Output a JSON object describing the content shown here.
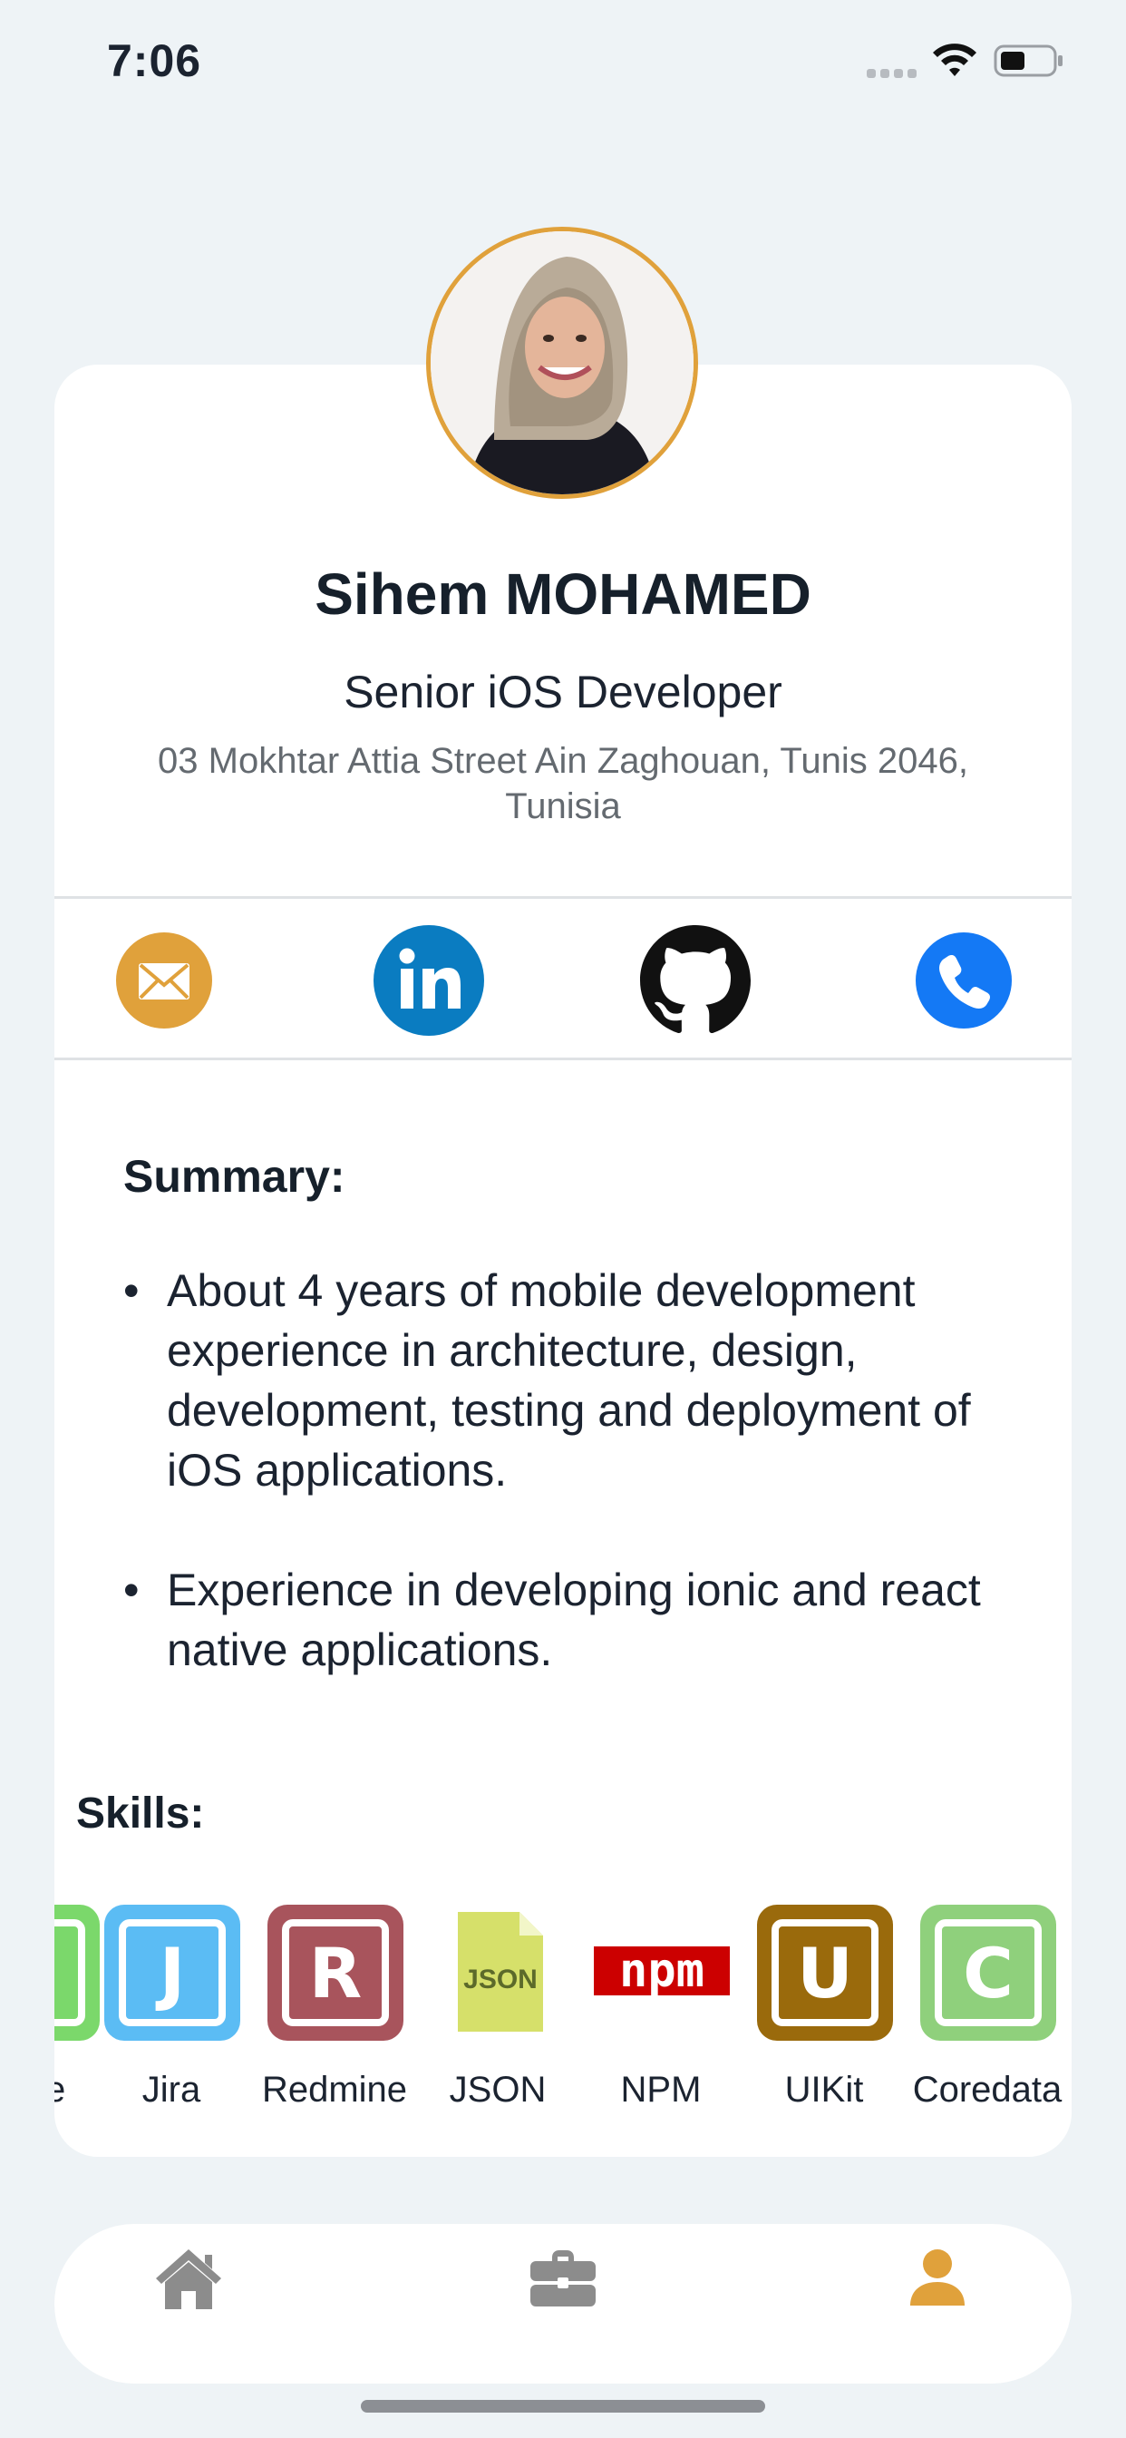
{
  "status_bar": {
    "time": "7:06"
  },
  "profile": {
    "name": "Sihem MOHAMED",
    "role": "Senior iOS Developer",
    "address": "03 Mokhtar Attia Street Ain Zaghouan, Tunis 2046, Tunisia"
  },
  "contacts": [
    {
      "icon": "envelope-icon",
      "color": "#e0a13b"
    },
    {
      "icon": "linkedin-icon",
      "color": "#0a7cc1"
    },
    {
      "icon": "github-icon",
      "color": "#111111"
    },
    {
      "icon": "phone-icon",
      "color": "#1479f5"
    }
  ],
  "summary": {
    "title": "Summary:",
    "items": [
      "About 4 years of mobile development experience in architecture, design, development, testing and deployment of iOS applications.",
      "Experience in developing ionic and react native applications."
    ]
  },
  "skills": {
    "title": "Skills:",
    "items": [
      {
        "label": "ke",
        "letter": "",
        "color": "#7bd86b"
      },
      {
        "label": "Jira",
        "letter": "J",
        "color": "#5bbcf4"
      },
      {
        "label": "Redmine",
        "letter": "R",
        "color": "#a8545c"
      },
      {
        "label": "JSON",
        "letter": "JSON",
        "color": "#d6e06a"
      },
      {
        "label": "NPM",
        "letter": "npm",
        "color": "#cc0000"
      },
      {
        "label": "UIKit",
        "letter": "U",
        "color": "#9a6a0c"
      },
      {
        "label": "Coredata",
        "letter": "C",
        "color": "#8fd07c"
      }
    ]
  },
  "tab_bar": {
    "tabs": [
      {
        "icon": "home-icon",
        "active": false
      },
      {
        "icon": "briefcase-icon",
        "active": false
      },
      {
        "icon": "person-icon",
        "active": true
      }
    ],
    "active_color": "#e0a13b",
    "inactive_color": "#8c8c8c"
  }
}
